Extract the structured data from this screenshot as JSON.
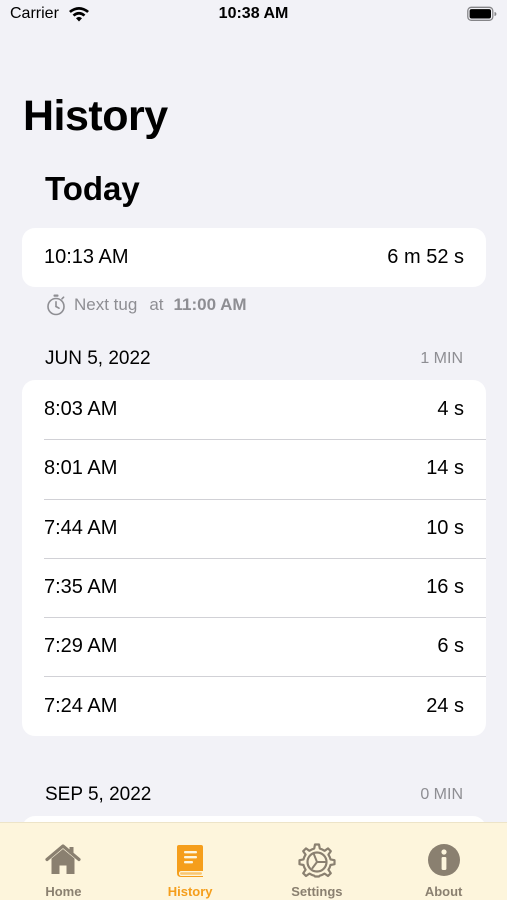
{
  "status_bar": {
    "carrier": "Carrier",
    "time": "10:38 AM"
  },
  "nav": {
    "title": "History"
  },
  "today": {
    "title": "Today",
    "entries": [
      {
        "time": "10:13 AM",
        "duration": "6 m 52 s"
      }
    ],
    "next_tug": {
      "label": "Next tug",
      "at": "at",
      "time": "11:00 AM"
    }
  },
  "sections": [
    {
      "date": "JUN 5, 2022",
      "total": "1 MIN",
      "entries": [
        {
          "time": "8:03 AM",
          "duration": "4 s"
        },
        {
          "time": "8:01 AM",
          "duration": "14 s"
        },
        {
          "time": "7:44 AM",
          "duration": "10 s"
        },
        {
          "time": "7:35 AM",
          "duration": "16 s"
        },
        {
          "time": "7:29 AM",
          "duration": "6 s"
        },
        {
          "time": "7:24 AM",
          "duration": "24 s"
        }
      ]
    },
    {
      "date": "SEP 5, 2022",
      "total": "0 MIN",
      "entries": []
    }
  ],
  "tab_bar": {
    "tabs": [
      {
        "label": "Home",
        "icon": "home-icon",
        "active": false
      },
      {
        "label": "History",
        "icon": "book-icon",
        "active": true
      },
      {
        "label": "Settings",
        "icon": "gear-icon",
        "active": false
      },
      {
        "label": "About",
        "icon": "info-icon",
        "active": false
      }
    ]
  },
  "colors": {
    "background": "#f2f2f7",
    "card": "#ffffff",
    "tab_bar_bg": "#fdf5dc",
    "tab_inactive": "#8a8070",
    "tab_active": "#f59e1b",
    "secondary_text": "#8e8e93"
  }
}
